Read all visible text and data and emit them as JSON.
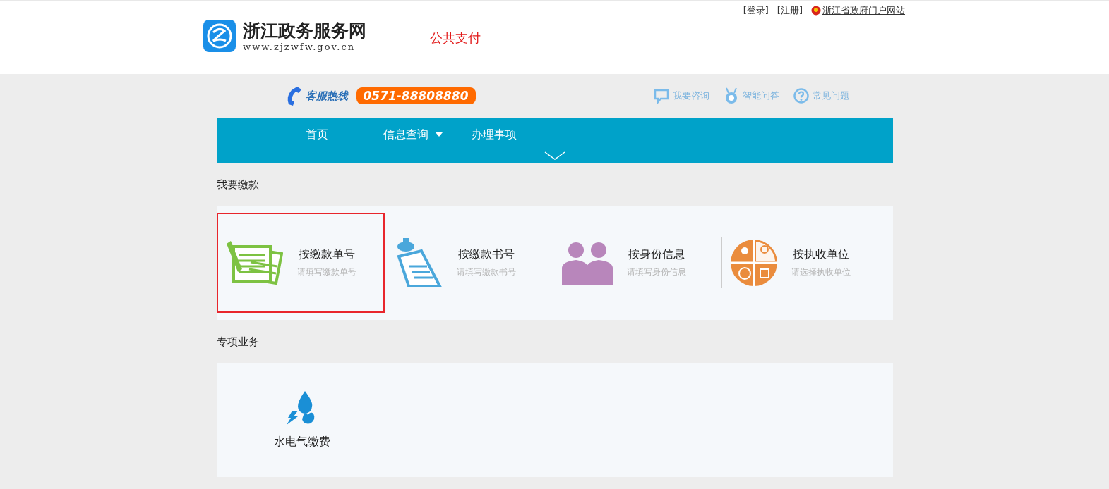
{
  "header": {
    "logo_title": "浙江政务服务网",
    "logo_url": "www.zjzwfw.gov.cn",
    "section_title": "公共支付",
    "top_links": [
      "[登录]",
      "[注册]"
    ],
    "portal_link": "浙江省政府门户网站"
  },
  "hotline": {
    "label": "客服热线",
    "number": "0571-88808880"
  },
  "help_links": [
    {
      "label": "我要咨询"
    },
    {
      "label": "智能问答"
    },
    {
      "label": "常见问题"
    }
  ],
  "nav": [
    {
      "label": "首页",
      "dropdown": false
    },
    {
      "label": "信息查询",
      "dropdown": true
    },
    {
      "label": "办理事项",
      "dropdown": false
    }
  ],
  "payment": {
    "title": "我要缴款",
    "options": [
      {
        "title": "按缴款单号",
        "hint": "请填写缴款单号",
        "selected": true
      },
      {
        "title": "按缴款书号",
        "hint": "请填写缴款书号",
        "selected": false
      },
      {
        "title": "按身份信息",
        "hint": "请填写身份信息",
        "selected": false
      },
      {
        "title": "按执收单位",
        "hint": "请选择执收单位",
        "selected": false
      }
    ]
  },
  "special": {
    "title": "专项业务",
    "items": [
      {
        "label": "水电气缴费"
      }
    ]
  }
}
